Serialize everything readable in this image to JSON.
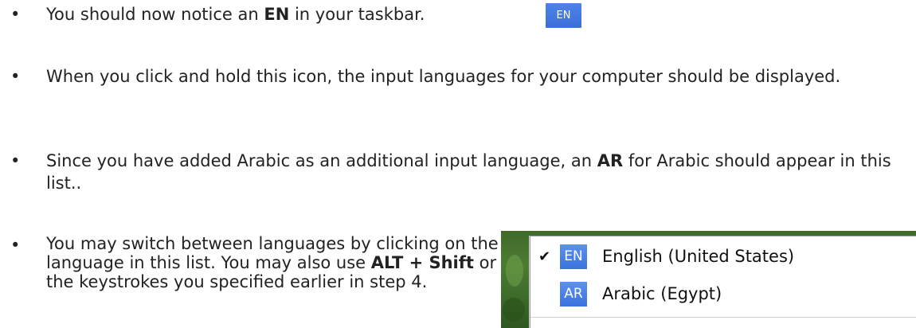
{
  "bullets": [
    {
      "marker": "•",
      "parts": [
        "You should now notice an ",
        "EN",
        " in your taskbar."
      ]
    },
    {
      "marker": "•",
      "text": "When you click and hold this icon, the input languages for your computer should be displayed."
    },
    {
      "marker": "•",
      "parts": [
        "Since you have added Arabic as an additional input language, an ",
        "AR",
        " for Arabic should appear in this list.."
      ]
    },
    {
      "marker": "•",
      "parts": [
        "You may switch between languages by clicking on the language in this list. You may also use ",
        "ALT + Shift",
        " or the keystrokes you specified earlier in step 4."
      ]
    }
  ],
  "taskbar_icon": {
    "label": "EN",
    "color": "#3f76e0"
  },
  "language_menu": {
    "items": [
      {
        "checked": true,
        "check_mark": "✔",
        "badge": "EN",
        "name": "English (United States)"
      },
      {
        "checked": false,
        "check_mark": "",
        "badge": "AR",
        "name": "Arabic (Egypt)"
      }
    ]
  }
}
